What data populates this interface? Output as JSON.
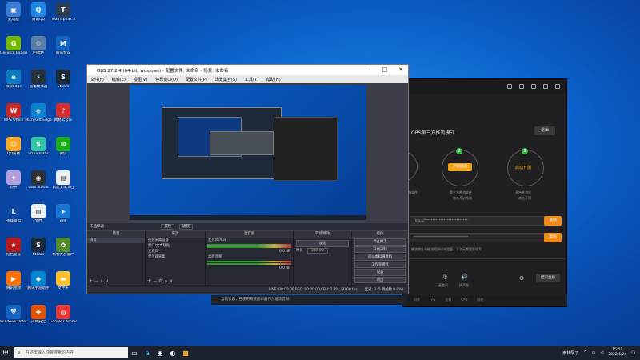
{
  "desktop": {
    "icons": [
      {
        "label": "此电脑",
        "color": "#3a7bd5",
        "glyph": "▣"
      },
      {
        "label": "腾讯QQ",
        "color": "#1e88e5",
        "glyph": "Q"
      },
      {
        "label": "TeamSpeak 3",
        "color": "#2c3e50",
        "glyph": "T"
      },
      {
        "label": "GeForce Experience",
        "color": "#76b900",
        "glyph": "G"
      },
      {
        "label": "回收站",
        "color": "#5c7fa8",
        "glyph": "♲"
      },
      {
        "label": "腾讯会议",
        "color": "#1565c0",
        "glyph": "M"
      },
      {
        "label": "微软Edge",
        "color": "#0c7bbf",
        "glyph": "e"
      },
      {
        "label": "雷电模拟器",
        "color": "#263238",
        "glyph": "⚡"
      },
      {
        "label": "Steam",
        "color": "#1b2838",
        "glyph": "S"
      },
      {
        "label": "WPS Office",
        "color": "#c62828",
        "glyph": "W"
      },
      {
        "label": "Microsoft Edge",
        "color": "#0a84d0",
        "glyph": "e"
      },
      {
        "label": "网易云音乐",
        "color": "#d32f2f",
        "glyph": "♪"
      },
      {
        "label": "QQ游戏",
        "color": "#f9a825",
        "glyph": "☺"
      },
      {
        "label": "Streamlabs",
        "color": "#31c3a2",
        "glyph": "S"
      },
      {
        "label": "微信",
        "color": "#1aad19",
        "glyph": "✉"
      },
      {
        "label": "原神",
        "color": "#b39ddb",
        "glyph": "✦"
      },
      {
        "label": "OBS Studio",
        "color": "#303030",
        "glyph": "◉"
      },
      {
        "label": "新建文本文档",
        "color": "#eceff1",
        "glyph": "▤"
      },
      {
        "label": "英雄联盟",
        "color": "#0d47a1",
        "glyph": "L"
      },
      {
        "label": "文档",
        "color": "#eceff1",
        "glyph": "▤"
      },
      {
        "label": "迅雷",
        "color": "#1976d2",
        "glyph": "➤"
      },
      {
        "label": "红色警戒",
        "color": "#b71c1c",
        "glyph": "★"
      },
      {
        "label": "Steam",
        "color": "#1b2838",
        "glyph": "S"
      },
      {
        "label": "植物大战僵尸",
        "color": "#558b2f",
        "glyph": "✿"
      },
      {
        "label": "腾讯视频",
        "color": "#ff6f00",
        "glyph": "▶"
      },
      {
        "label": "腾讯手游助手",
        "color": "#0288d1",
        "glyph": "◆"
      },
      {
        "label": "文件夹",
        "color": "#fbc02d",
        "glyph": "▬"
      },
      {
        "label": "Windows Defender",
        "color": "#1565c0",
        "glyph": "⛨"
      },
      {
        "label": "火绒安全",
        "color": "#e65100",
        "glyph": "✚"
      },
      {
        "label": "Google Chrome",
        "color": "#e53935",
        "glyph": "◎"
      }
    ]
  },
  "right_app": {
    "mode_title": "OBS第三方推流模式",
    "exit_label": "退出",
    "step_btn": "开始推流",
    "caption_left": "推流软件",
    "caption_mid1": "第三方推流软件",
    "caption_mid2": "点击开始推流",
    "caption_right1": "开始推流后",
    "caption_right2": "点击开播",
    "start_btn": "启动开播",
    "field1": "rtmp://***************************",
    "field2": "**********************************",
    "copy1": "复制",
    "copy2": "复制",
    "hint": "推流地址与推流密钥请勿泄露，下次无需重复填写",
    "mic_label": "麦克风",
    "speaker_label": "扬声器",
    "end_btn": "结束直播",
    "stats": [
      "码率",
      "FPS",
      "丢帧",
      "CPU",
      "网络"
    ]
  },
  "obs": {
    "title": "OBS 27.2.4 (64-bit, windows) - 配置文件: 未命名 - 场景: 未命名",
    "menu": [
      "文件(F)",
      "编辑(E)",
      "视图(V)",
      "停靠窗口(D)",
      "配置文件(P)",
      "场景集合(S)",
      "工具(T)",
      "帮助(H)"
    ],
    "scene_label": "未选择源",
    "props": "属性",
    "filters": "滤镜",
    "docks": {
      "scenes": "场景",
      "sources": "来源",
      "mixer": "混音器",
      "transitions": "转场特效",
      "controls": "控件"
    },
    "scene_items": [
      "场景"
    ],
    "source_items": [
      "视频采集设备",
      "窗口/文本粘贴",
      "麦克风",
      "显示器采集"
    ],
    "mixer_items": [
      {
        "name": "麦克风/Aux",
        "db": "0.0 dB"
      },
      {
        "name": "桌面音频",
        "db": "0.0 dB"
      }
    ],
    "transition": "淡化",
    "duration_label": "时长",
    "duration_value": "300 ms",
    "controls": [
      "停止推流",
      "开始录制",
      "启动虚拟摄像机",
      "工作室模式",
      "设置",
      "退出"
    ],
    "status": "LIVE: 00:00:00   REC: 00:00:00   CPU: 1.9%, 60.00 fps",
    "delay": "延迟: 0 (5 跳帧数 0.0%)"
  },
  "notification": "当前状态，已使用系统扬声器作为推流音频",
  "taskbar": {
    "search_placeholder": "在这里输入你要搜索的内容",
    "weather": "雨转阴了",
    "time": "15:01",
    "date": "2022/6/24"
  }
}
